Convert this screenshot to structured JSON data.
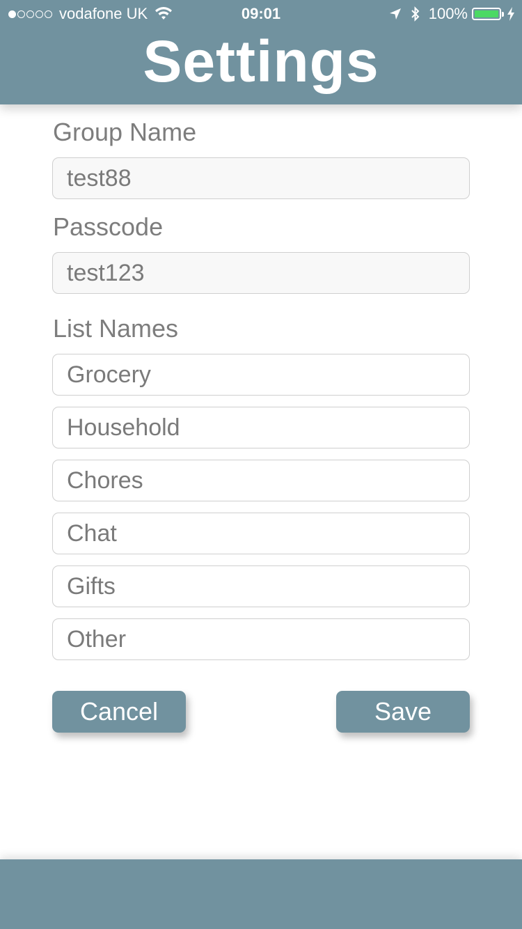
{
  "status_bar": {
    "carrier": "vodafone UK",
    "time": "09:01",
    "battery_percent": "100%",
    "signal_bars_filled": 1,
    "signal_bars_total": 5,
    "battery_level": 1.0,
    "battery_color": "#4cd964"
  },
  "header": {
    "title": "Settings",
    "background_color": "#71929f"
  },
  "form": {
    "group_name_label": "Group Name",
    "group_name_value": "test88",
    "passcode_label": "Passcode",
    "passcode_value": "test123",
    "list_names_label": "List Names",
    "list_names": [
      {
        "placeholder": "Grocery"
      },
      {
        "placeholder": "Household"
      },
      {
        "placeholder": "Chores"
      },
      {
        "placeholder": "Chat"
      },
      {
        "placeholder": "Gifts"
      },
      {
        "placeholder": "Other"
      }
    ]
  },
  "buttons": {
    "cancel_label": "Cancel",
    "save_label": "Save"
  },
  "icons": {
    "wifi": "wifi-icon",
    "location": "location-arrow-icon",
    "bluetooth": "bluetooth-icon",
    "battery": "battery-icon",
    "charging": "charging-bolt-icon"
  }
}
